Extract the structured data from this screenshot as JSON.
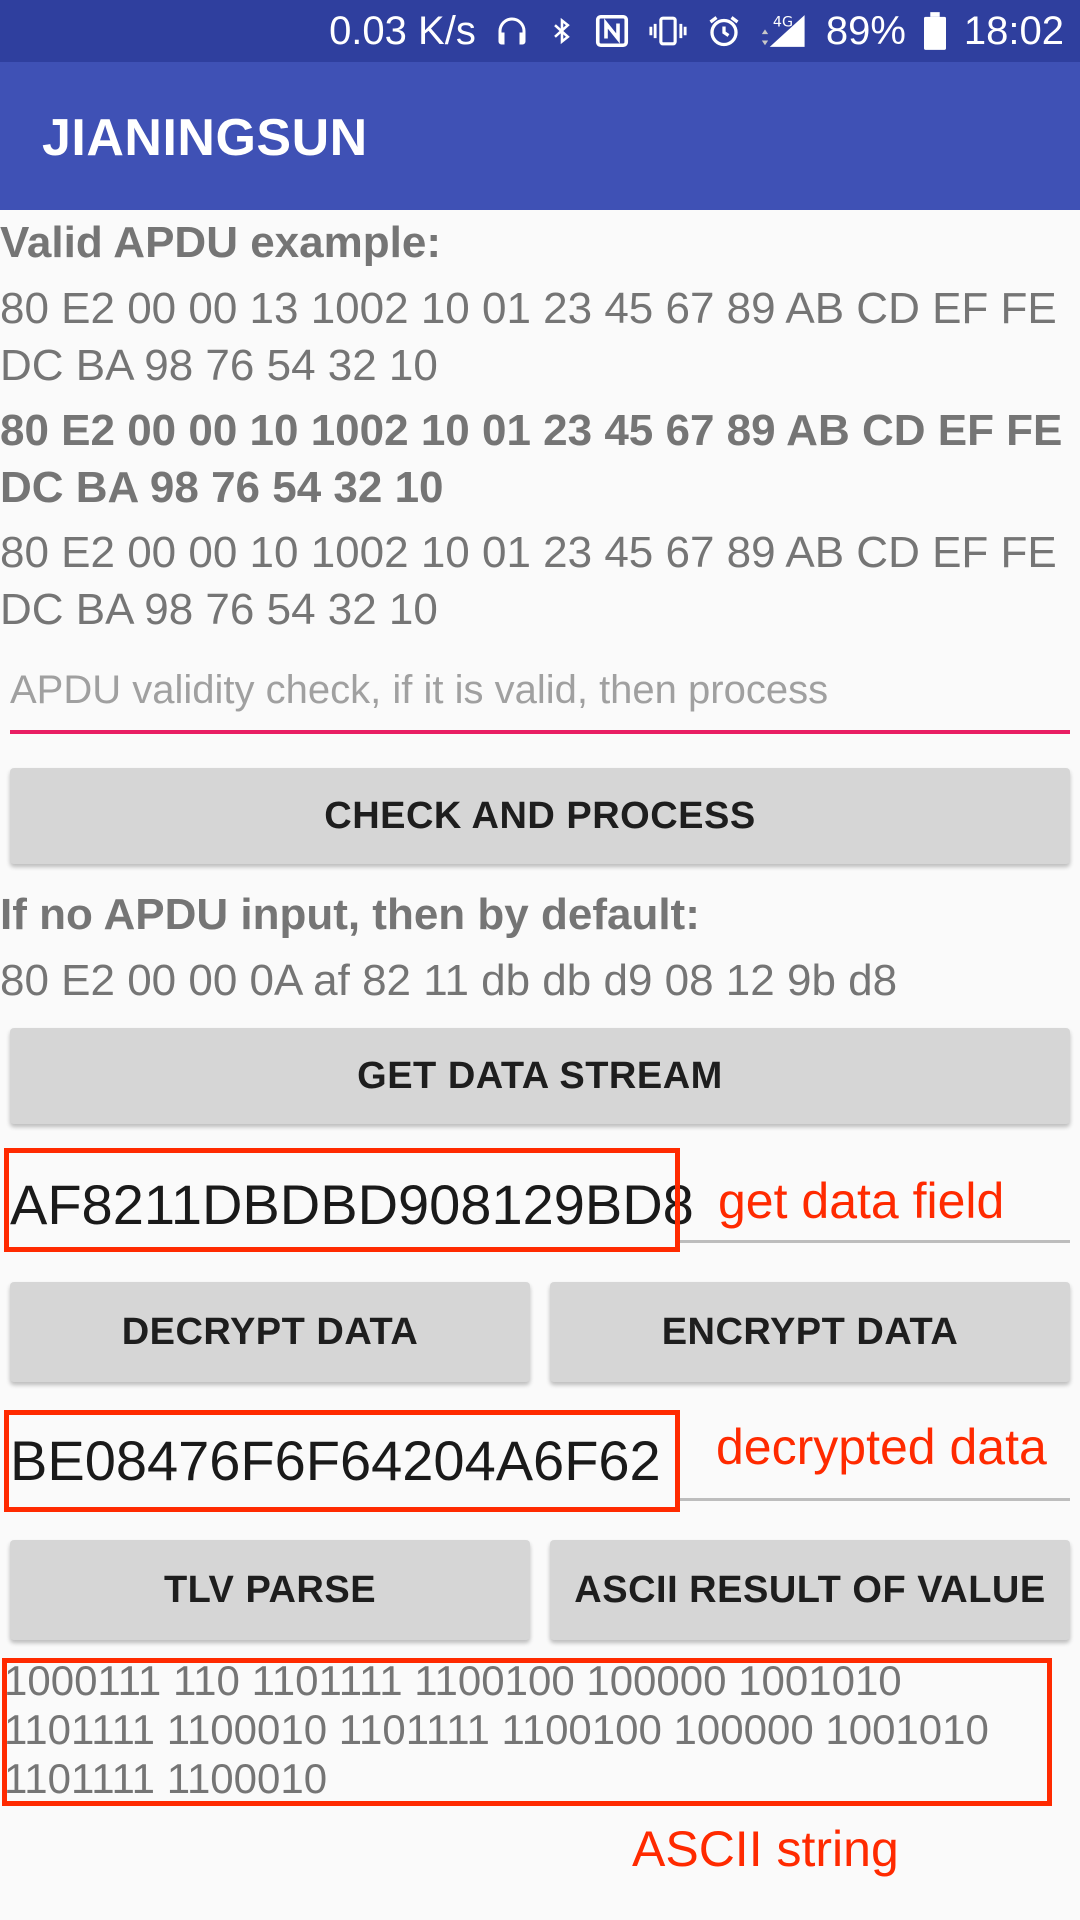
{
  "status_bar": {
    "speed": "0.03 K/s",
    "network": "4G",
    "battery": "89%",
    "time": "18:02"
  },
  "app_bar": {
    "title": "JIANINGSUN"
  },
  "examples": {
    "heading": "Valid APDU example:",
    "line1": "80 E2 00 00 13 1002 10 01 23 45 67 89 AB CD EF FE DC BA 98 76 54 32 10",
    "line2": "80 E2 00 00 10 1002 10 01 23 45 67 89 AB CD EF FE DC BA 98 76 54 32 10",
    "line3": "80 E2 00 00 10 1002 10 01 23 45 67 89 AB CD EF FE DC BA 98 76 54 32 10"
  },
  "apdu_input": {
    "value": "",
    "placeholder": "APDU validity check, if it is valid, then process"
  },
  "buttons": {
    "check_process": "CHECK AND PROCESS",
    "get_stream": "GET DATA STREAM",
    "decrypt": "DECRYPT DATA",
    "encrypt": "ENCRYPT DATA",
    "tlv_parse": "TLV PARSE",
    "ascii_result": "ASCII RESULT OF VALUE"
  },
  "default_section": {
    "heading": "If no APDU input, then by default:",
    "value": "80 E2 00 00 0A af 82 11 db db d9 08 12 9b d8"
  },
  "data_field": {
    "value": "AF8211DBDBD908129BD8",
    "annotation": "get data field"
  },
  "decrypted_field": {
    "value": "BE08476F6F64204A6F62",
    "annotation": "decrypted data"
  },
  "ascii_output": {
    "text": "1000111 110 1101111 1100100 100000 1001010 1101111 1100010  1101111 1100100 100000 1001010 1101111 1100010",
    "annotation": "ASCII string"
  },
  "colors": {
    "primary": "#3f51b5",
    "primary_dark": "#2f3f9e",
    "accent": "#e91e63",
    "annotation_red": "#ff2a00"
  }
}
